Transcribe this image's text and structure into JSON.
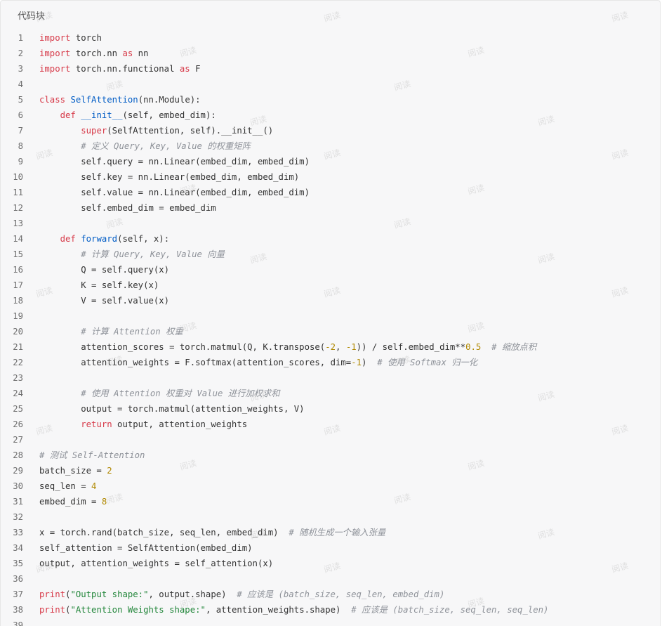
{
  "header": {
    "title": "代码块"
  },
  "watermark": "阅读",
  "lines": [
    [
      [
        "kw",
        "import"
      ],
      [
        "tx",
        " torch"
      ]
    ],
    [
      [
        "kw",
        "import"
      ],
      [
        "tx",
        " torch.nn "
      ],
      [
        "kw",
        "as"
      ],
      [
        "tx",
        " nn"
      ]
    ],
    [
      [
        "kw",
        "import"
      ],
      [
        "tx",
        " torch.nn.functional "
      ],
      [
        "kw",
        "as"
      ],
      [
        "tx",
        " F"
      ]
    ],
    [],
    [
      [
        "kw",
        "class"
      ],
      [
        "tx",
        " "
      ],
      [
        "fn",
        "SelfAttention"
      ],
      [
        "tx",
        "(nn.Module):"
      ]
    ],
    [
      [
        "tx",
        "    "
      ],
      [
        "kw",
        "def"
      ],
      [
        "tx",
        " "
      ],
      [
        "fn",
        "__init__"
      ],
      [
        "tx",
        "(self, embed_dim):"
      ]
    ],
    [
      [
        "tx",
        "        "
      ],
      [
        "bi",
        "super"
      ],
      [
        "tx",
        "(SelfAttention, self).__init__()"
      ]
    ],
    [
      [
        "tx",
        "        "
      ],
      [
        "cm",
        "# 定义 Query, Key, Value 的权重矩阵"
      ]
    ],
    [
      [
        "tx",
        "        self.query = nn.Linear(embed_dim, embed_dim)"
      ]
    ],
    [
      [
        "tx",
        "        self.key = nn.Linear(embed_dim, embed_dim)"
      ]
    ],
    [
      [
        "tx",
        "        self.value = nn.Linear(embed_dim, embed_dim)"
      ]
    ],
    [
      [
        "tx",
        "        self.embed_dim = embed_dim"
      ]
    ],
    [],
    [
      [
        "tx",
        "    "
      ],
      [
        "kw",
        "def"
      ],
      [
        "tx",
        " "
      ],
      [
        "fn",
        "forward"
      ],
      [
        "tx",
        "(self, x):"
      ]
    ],
    [
      [
        "tx",
        "        "
      ],
      [
        "cm",
        "# 计算 Query, Key, Value 向量"
      ]
    ],
    [
      [
        "tx",
        "        Q = self.query(x)"
      ]
    ],
    [
      [
        "tx",
        "        K = self.key(x)"
      ]
    ],
    [
      [
        "tx",
        "        V = self.value(x)"
      ]
    ],
    [],
    [
      [
        "tx",
        "        "
      ],
      [
        "cm",
        "# 计算 Attention 权重"
      ]
    ],
    [
      [
        "tx",
        "        attention_scores = torch.matmul(Q, K.transpose("
      ],
      [
        "num",
        "-2"
      ],
      [
        "tx",
        ", "
      ],
      [
        "num",
        "-1"
      ],
      [
        "tx",
        ")) / self.embed_dim**"
      ],
      [
        "num",
        "0.5"
      ],
      [
        "tx",
        "  "
      ],
      [
        "cm",
        "# 缩放点积"
      ]
    ],
    [
      [
        "tx",
        "        attention_weights = F.softmax(attention_scores, dim="
      ],
      [
        "num",
        "-1"
      ],
      [
        "tx",
        ")  "
      ],
      [
        "cm",
        "# 使用 Softmax 归一化"
      ]
    ],
    [],
    [
      [
        "tx",
        "        "
      ],
      [
        "cm",
        "# 使用 Attention 权重对 Value 进行加权求和"
      ]
    ],
    [
      [
        "tx",
        "        output = torch.matmul(attention_weights, V)"
      ]
    ],
    [
      [
        "tx",
        "        "
      ],
      [
        "kw",
        "return"
      ],
      [
        "tx",
        " output, attention_weights"
      ]
    ],
    [],
    [
      [
        "cm",
        "# 测试 Self-Attention"
      ]
    ],
    [
      [
        "tx",
        "batch_size = "
      ],
      [
        "num",
        "2"
      ]
    ],
    [
      [
        "tx",
        "seq_len = "
      ],
      [
        "num",
        "4"
      ]
    ],
    [
      [
        "tx",
        "embed_dim = "
      ],
      [
        "num",
        "8"
      ]
    ],
    [],
    [
      [
        "tx",
        "x = torch.rand(batch_size, seq_len, embed_dim)  "
      ],
      [
        "cm",
        "# 随机生成一个输入张量"
      ]
    ],
    [
      [
        "tx",
        "self_attention = SelfAttention(embed_dim)"
      ]
    ],
    [
      [
        "tx",
        "output, attention_weights = self_attention(x)"
      ]
    ],
    [],
    [
      [
        "bi",
        "print"
      ],
      [
        "tx",
        "("
      ],
      [
        "str",
        "\"Output shape:\""
      ],
      [
        "tx",
        ", output.shape)  "
      ],
      [
        "cm",
        "# 应该是 (batch_size, seq_len, embed_dim)"
      ]
    ],
    [
      [
        "bi",
        "print"
      ],
      [
        "tx",
        "("
      ],
      [
        "str",
        "\"Attention Weights shape:\""
      ],
      [
        "tx",
        ", attention_weights.shape)  "
      ],
      [
        "cm",
        "# 应该是 (batch_size, seq_len, seq_len)"
      ]
    ],
    []
  ]
}
